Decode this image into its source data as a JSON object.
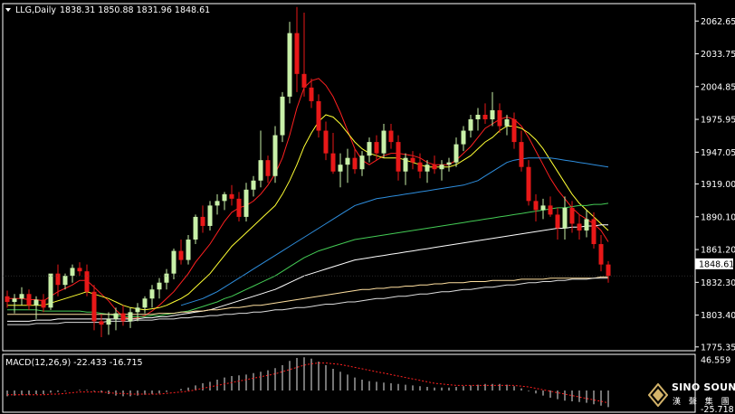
{
  "chart_data": {
    "type": "candlestick",
    "symbol": "LLG",
    "timeframe": "Daily",
    "header": {
      "symbol_tf": "LLG,Daily",
      "ohlc": "1838.31 1850.88 1831.96 1848.61"
    },
    "price_axis": {
      "ticks": [
        "2062.65",
        "2033.75",
        "2004.85",
        "1975.95",
        "1947.05",
        "1919.00",
        "1890.10",
        "1861.20",
        "1832.30",
        "1803.40",
        "1775.35"
      ],
      "tick_values": [
        2062.65,
        2033.75,
        2004.85,
        1975.95,
        1947.05,
        1919.0,
        1890.1,
        1861.2,
        1832.3,
        1803.4,
        1775.35
      ],
      "current_price_label": "1848.61",
      "range": [
        1772,
        2078
      ]
    },
    "candles": [
      [
        1820,
        1825,
        1810,
        1815
      ],
      [
        1815,
        1822,
        1805,
        1818
      ],
      [
        1818,
        1828,
        1812,
        1822
      ],
      [
        1822,
        1826,
        1808,
        1812
      ],
      [
        1812,
        1820,
        1800,
        1817
      ],
      [
        1817,
        1822,
        1806,
        1810
      ],
      [
        1810,
        1836,
        1808,
        1840
      ],
      [
        1840,
        1848,
        1820,
        1830
      ],
      [
        1830,
        1840,
        1826,
        1838
      ],
      [
        1838,
        1848,
        1832,
        1845
      ],
      [
        1845,
        1850,
        1838,
        1842
      ],
      [
        1842,
        1848,
        1820,
        1824
      ],
      [
        1824,
        1830,
        1790,
        1798
      ],
      [
        1798,
        1804,
        1784,
        1795
      ],
      [
        1795,
        1806,
        1786,
        1800
      ],
      [
        1800,
        1810,
        1790,
        1805
      ],
      [
        1805,
        1812,
        1794,
        1798
      ],
      [
        1798,
        1810,
        1792,
        1806
      ],
      [
        1806,
        1814,
        1798,
        1810
      ],
      [
        1810,
        1820,
        1805,
        1818
      ],
      [
        1818,
        1830,
        1810,
        1826
      ],
      [
        1826,
        1836,
        1818,
        1832
      ],
      [
        1832,
        1844,
        1826,
        1840
      ],
      [
        1840,
        1862,
        1835,
        1860
      ],
      [
        1860,
        1870,
        1848,
        1852
      ],
      [
        1852,
        1874,
        1848,
        1870
      ],
      [
        1870,
        1892,
        1866,
        1890
      ],
      [
        1890,
        1900,
        1876,
        1882
      ],
      [
        1882,
        1904,
        1878,
        1900
      ],
      [
        1900,
        1910,
        1892,
        1904
      ],
      [
        1904,
        1912,
        1896,
        1910
      ],
      [
        1910,
        1918,
        1900,
        1906
      ],
      [
        1906,
        1912,
        1886,
        1890
      ],
      [
        1890,
        1920,
        1886,
        1914
      ],
      [
        1914,
        1926,
        1908,
        1922
      ],
      [
        1922,
        1966,
        1916,
        1940
      ],
      [
        1940,
        1944,
        1920,
        1926
      ],
      [
        1926,
        1970,
        1920,
        1962
      ],
      [
        1962,
        2000,
        1956,
        1996
      ],
      [
        1996,
        2062,
        1990,
        2052
      ],
      [
        2052,
        2075,
        2000,
        2016
      ],
      [
        2016,
        2070,
        1996,
        2004
      ],
      [
        2004,
        2012,
        1986,
        1992
      ],
      [
        1992,
        1998,
        1960,
        1966
      ],
      [
        1966,
        1974,
        1940,
        1946
      ],
      [
        1946,
        1964,
        1928,
        1930
      ],
      [
        1930,
        1946,
        1916,
        1936
      ],
      [
        1936,
        1950,
        1920,
        1942
      ],
      [
        1942,
        1950,
        1928,
        1932
      ],
      [
        1932,
        1948,
        1926,
        1944
      ],
      [
        1944,
        1960,
        1938,
        1956
      ],
      [
        1956,
        1962,
        1940,
        1946
      ],
      [
        1946,
        1972,
        1942,
        1966
      ],
      [
        1966,
        1972,
        1950,
        1956
      ],
      [
        1956,
        1962,
        1922,
        1930
      ],
      [
        1930,
        1946,
        1918,
        1942
      ],
      [
        1942,
        1948,
        1932,
        1938
      ],
      [
        1938,
        1946,
        1924,
        1930
      ],
      [
        1930,
        1940,
        1920,
        1936
      ],
      [
        1936,
        1944,
        1928,
        1932
      ],
      [
        1932,
        1940,
        1922,
        1936
      ],
      [
        1936,
        1942,
        1930,
        1938
      ],
      [
        1938,
        1960,
        1934,
        1954
      ],
      [
        1954,
        1970,
        1948,
        1966
      ],
      [
        1966,
        1980,
        1960,
        1976
      ],
      [
        1976,
        1986,
        1966,
        1980
      ],
      [
        1980,
        1990,
        1972,
        1976
      ],
      [
        1976,
        2000,
        1970,
        1984
      ],
      [
        1984,
        1990,
        1964,
        1970
      ],
      [
        1970,
        1980,
        1962,
        1976
      ],
      [
        1976,
        1982,
        1950,
        1956
      ],
      [
        1956,
        1966,
        1930,
        1934
      ],
      [
        1934,
        1940,
        1900,
        1904
      ],
      [
        1904,
        1910,
        1886,
        1896
      ],
      [
        1896,
        1906,
        1888,
        1900
      ],
      [
        1900,
        1908,
        1890,
        1892
      ],
      [
        1892,
        1898,
        1870,
        1880
      ],
      [
        1880,
        1908,
        1870,
        1898
      ],
      [
        1898,
        1904,
        1876,
        1884
      ],
      [
        1884,
        1892,
        1870,
        1878
      ],
      [
        1878,
        1896,
        1872,
        1888
      ],
      [
        1888,
        1894,
        1862,
        1866
      ],
      [
        1866,
        1874,
        1842,
        1848
      ],
      [
        1848,
        1851,
        1832,
        1838
      ]
    ],
    "moving_averages": [
      {
        "color": "#ff2020",
        "values": [
          1818,
          1818,
          1818,
          1817,
          1817,
          1816,
          1820,
          1824,
          1827,
          1830,
          1834,
          1834,
          1828,
          1822,
          1816,
          1808,
          1802,
          1800,
          1801,
          1803,
          1807,
          1812,
          1818,
          1824,
          1832,
          1840,
          1850,
          1858,
          1866,
          1876,
          1886,
          1894,
          1898,
          1900,
          1904,
          1910,
          1918,
          1928,
          1942,
          1962,
          1986,
          2004,
          2010,
          2012,
          2006,
          1996,
          1982,
          1966,
          1950,
          1940,
          1936,
          1940,
          1944,
          1946,
          1946,
          1945,
          1944,
          1942,
          1938,
          1936,
          1936,
          1936,
          1940,
          1946,
          1952,
          1960,
          1968,
          1972,
          1976,
          1978,
          1976,
          1970,
          1960,
          1948,
          1936,
          1924,
          1914,
          1906,
          1898,
          1892,
          1888,
          1884,
          1878,
          1868
        ]
      },
      {
        "color": "#ffff33",
        "values": [
          1812,
          1812,
          1812,
          1812,
          1812,
          1812,
          1814,
          1816,
          1818,
          1820,
          1822,
          1824,
          1822,
          1820,
          1818,
          1815,
          1812,
          1810,
          1809,
          1808,
          1809,
          1810,
          1812,
          1815,
          1818,
          1822,
          1828,
          1834,
          1840,
          1848,
          1856,
          1864,
          1870,
          1876,
          1882,
          1888,
          1894,
          1900,
          1910,
          1922,
          1936,
          1952,
          1964,
          1974,
          1980,
          1978,
          1972,
          1964,
          1956,
          1950,
          1946,
          1944,
          1942,
          1942,
          1942,
          1940,
          1938,
          1936,
          1934,
          1934,
          1934,
          1934,
          1936,
          1940,
          1944,
          1950,
          1956,
          1960,
          1966,
          1970,
          1970,
          1968,
          1964,
          1958,
          1950,
          1940,
          1930,
          1920,
          1910,
          1902,
          1896,
          1890,
          1884,
          1878
        ]
      },
      {
        "color": "#2e8ede",
        "values": [
          null,
          null,
          null,
          null,
          null,
          null,
          null,
          null,
          null,
          null,
          null,
          null,
          null,
          null,
          null,
          null,
          null,
          null,
          null,
          null,
          null,
          null,
          null,
          null,
          1812,
          1814,
          1816,
          1818,
          1821,
          1824,
          1828,
          1832,
          1836,
          1840,
          1844,
          1848,
          1852,
          1856,
          1860,
          1864,
          1868,
          1872,
          1876,
          1880,
          1884,
          1888,
          1892,
          1896,
          1900,
          1902,
          1904,
          1906,
          1907,
          1908,
          1909,
          1910,
          1911,
          1912,
          1913,
          1914,
          1915,
          1916,
          1917,
          1918,
          1920,
          1922,
          1926,
          1930,
          1934,
          1938,
          1940,
          1941,
          1942,
          1942,
          1942,
          1942,
          1941,
          1940,
          1939,
          1938,
          1937,
          1936,
          1935,
          1934
        ]
      },
      {
        "color": "#44cc55",
        "values": [
          1808,
          1808,
          1808,
          1808,
          1808,
          1807,
          1807,
          1807,
          1807,
          1807,
          1807,
          1806,
          1806,
          1805,
          1804,
          1803,
          1802,
          1802,
          1802,
          1802,
          1803,
          1803,
          1804,
          1805,
          1806,
          1807,
          1809,
          1811,
          1813,
          1815,
          1818,
          1820,
          1823,
          1826,
          1829,
          1832,
          1835,
          1838,
          1842,
          1846,
          1850,
          1854,
          1857,
          1860,
          1862,
          1864,
          1866,
          1868,
          1870,
          1871,
          1872,
          1873,
          1874,
          1875,
          1876,
          1877,
          1878,
          1879,
          1880,
          1881,
          1882,
          1883,
          1884,
          1885,
          1886,
          1887,
          1888,
          1889,
          1890,
          1891,
          1892,
          1893,
          1894,
          1895,
          1896,
          1897,
          1898,
          1898,
          1899,
          1900,
          1900,
          1901,
          1901,
          1902
        ]
      },
      {
        "color": "#ffffff",
        "values": [
          1798,
          1798,
          1798,
          1798,
          1799,
          1799,
          1799,
          1800,
          1800,
          1800,
          1800,
          1800,
          1800,
          1800,
          1800,
          1800,
          1800,
          1800,
          1800,
          1801,
          1801,
          1802,
          1802,
          1803,
          1804,
          1805,
          1806,
          1807,
          1808,
          1810,
          1812,
          1814,
          1816,
          1818,
          1820,
          1822,
          1824,
          1826,
          1829,
          1832,
          1835,
          1838,
          1840,
          1842,
          1844,
          1846,
          1848,
          1850,
          1852,
          1853,
          1854,
          1855,
          1856,
          1857,
          1858,
          1859,
          1860,
          1861,
          1862,
          1863,
          1864,
          1865,
          1866,
          1867,
          1868,
          1869,
          1870,
          1871,
          1872,
          1873,
          1874,
          1875,
          1876,
          1877,
          1878,
          1879,
          1880,
          1880,
          1881,
          1881,
          1882,
          1882,
          1883,
          1883
        ]
      },
      {
        "color": "#ffe0a0",
        "values": [
          1804,
          1804,
          1804,
          1804,
          1804,
          1804,
          1804,
          1804,
          1804,
          1804,
          1804,
          1804,
          1804,
          1804,
          1804,
          1804,
          1804,
          1804,
          1804,
          1804,
          1804,
          1805,
          1805,
          1805,
          1806,
          1806,
          1807,
          1807,
          1808,
          1808,
          1809,
          1810,
          1810,
          1811,
          1812,
          1812,
          1813,
          1814,
          1815,
          1816,
          1817,
          1818,
          1819,
          1820,
          1821,
          1822,
          1823,
          1824,
          1825,
          1826,
          1826,
          1827,
          1827,
          1828,
          1828,
          1829,
          1829,
          1830,
          1830,
          1831,
          1831,
          1832,
          1832,
          1832,
          1833,
          1833,
          1833,
          1834,
          1834,
          1834,
          1834,
          1835,
          1835,
          1835,
          1835,
          1836,
          1836,
          1836,
          1836,
          1836,
          1836,
          1836,
          1837,
          1837
        ]
      },
      {
        "color": "#dddddd",
        "values": [
          1795,
          1795,
          1795,
          1795,
          1796,
          1796,
          1796,
          1796,
          1797,
          1797,
          1797,
          1797,
          1797,
          1797,
          1798,
          1798,
          1798,
          1798,
          1799,
          1799,
          1799,
          1800,
          1800,
          1800,
          1801,
          1801,
          1802,
          1802,
          1803,
          1803,
          1804,
          1804,
          1805,
          1805,
          1806,
          1806,
          1807,
          1808,
          1808,
          1809,
          1810,
          1810,
          1811,
          1812,
          1813,
          1813,
          1814,
          1815,
          1815,
          1816,
          1817,
          1818,
          1818,
          1819,
          1820,
          1820,
          1821,
          1822,
          1822,
          1823,
          1824,
          1824,
          1825,
          1826,
          1826,
          1827,
          1828,
          1828,
          1829,
          1830,
          1830,
          1831,
          1832,
          1832,
          1833,
          1833,
          1834,
          1834,
          1835,
          1835,
          1835,
          1836,
          1836,
          1836
        ]
      }
    ],
    "macd": {
      "label": "MACD(12,26,9) -22.433 -16.715",
      "axis_ticks": [
        "46.559",
        "-25.718"
      ],
      "range": [
        -30,
        50
      ],
      "histogram": [
        -8,
        -7,
        -6,
        -6,
        -5,
        -5,
        -3,
        -2,
        -1,
        0,
        1,
        1,
        -1,
        -3,
        -5,
        -7,
        -8,
        -8,
        -7,
        -6,
        -5,
        -4,
        -2,
        0,
        2,
        4,
        7,
        10,
        12,
        15,
        18,
        20,
        21,
        22,
        24,
        26,
        28,
        31,
        35,
        41,
        45,
        46,
        44,
        40,
        35,
        30,
        26,
        22,
        18,
        15,
        13,
        12,
        11,
        10,
        9,
        8,
        7,
        6,
        5,
        4,
        4,
        4,
        5,
        6,
        7,
        8,
        9,
        9,
        9,
        8,
        6,
        3,
        -1,
        -4,
        -7,
        -10,
        -12,
        -14,
        -15,
        -16,
        -17,
        -19,
        -21,
        -23
      ],
      "signal": [
        -6,
        -6,
        -6,
        -6,
        -6,
        -6,
        -5,
        -5,
        -4,
        -3,
        -2,
        -2,
        -2,
        -2,
        -3,
        -4,
        -4,
        -5,
        -5,
        -5,
        -5,
        -5,
        -4,
        -3,
        -2,
        -1,
        1,
        3,
        5,
        7,
        9,
        11,
        13,
        15,
        17,
        19,
        21,
        23,
        26,
        29,
        32,
        35,
        37,
        38,
        38,
        37,
        36,
        34,
        32,
        30,
        28,
        26,
        24,
        22,
        20,
        18,
        16,
        14,
        12,
        10,
        9,
        8,
        7,
        7,
        7,
        7,
        7,
        7,
        7,
        7,
        7,
        6,
        5,
        3,
        1,
        -1,
        -3,
        -5,
        -7,
        -9,
        -11,
        -13,
        -15,
        -17
      ]
    }
  },
  "watermark": {
    "brand": "SINO SOUND",
    "brand_cn": "漢 聲 集 團"
  },
  "colors": {
    "up_body": "#c8f0a8",
    "down_body": "#e81818",
    "background": "#000000",
    "axis_text": "#ffffff",
    "macd_hist": "#e8e8e8",
    "macd_signal": "#ff2020"
  }
}
